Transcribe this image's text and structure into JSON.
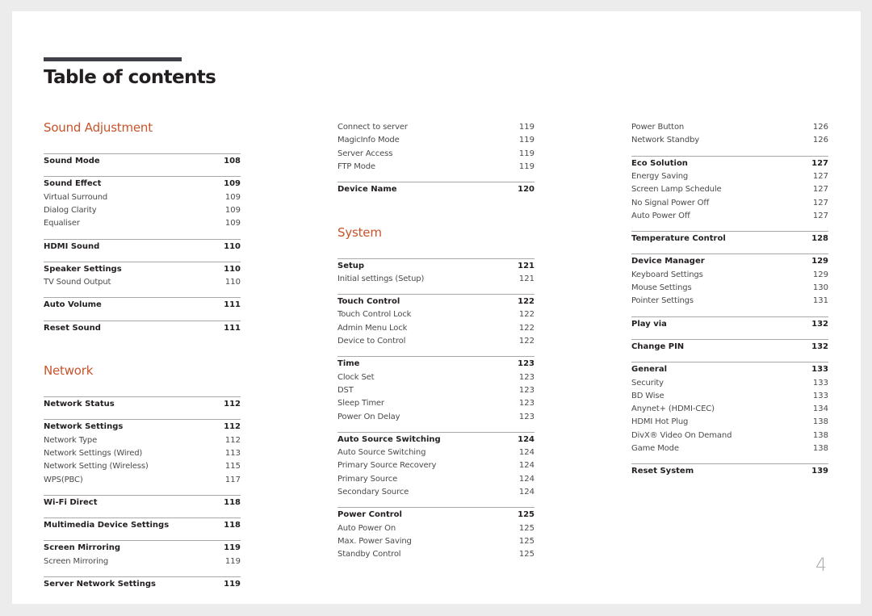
{
  "document": {
    "title": "Table of contents",
    "page_number": "4",
    "accent_color": "#c9532a"
  },
  "columns": [
    {
      "blocks": [
        {
          "type": "heading",
          "text": "Sound Adjustment"
        },
        {
          "type": "group",
          "items": [
            {
              "label": "Sound Mode",
              "page": "108",
              "major": true
            }
          ]
        },
        {
          "type": "group",
          "items": [
            {
              "label": "Sound Effect",
              "page": "109",
              "major": true
            },
            {
              "label": "Virtual Surround",
              "page": "109"
            },
            {
              "label": "Dialog Clarity",
              "page": "109"
            },
            {
              "label": "Equaliser",
              "page": "109"
            }
          ]
        },
        {
          "type": "group",
          "items": [
            {
              "label": "HDMI Sound",
              "page": "110",
              "major": true
            }
          ]
        },
        {
          "type": "group",
          "items": [
            {
              "label": "Speaker Settings",
              "page": "110",
              "major": true
            },
            {
              "label": "TV Sound Output",
              "page": "110"
            }
          ]
        },
        {
          "type": "group",
          "items": [
            {
              "label": "Auto Volume",
              "page": "111",
              "major": true
            }
          ]
        },
        {
          "type": "group",
          "items": [
            {
              "label": "Reset Sound",
              "page": "111",
              "major": true
            }
          ]
        },
        {
          "type": "heading",
          "text": "Network"
        },
        {
          "type": "group",
          "items": [
            {
              "label": "Network Status",
              "page": "112",
              "major": true
            }
          ]
        },
        {
          "type": "group",
          "items": [
            {
              "label": "Network Settings",
              "page": "112",
              "major": true
            },
            {
              "label": "Network Type",
              "page": "112"
            },
            {
              "label": "Network Settings (Wired)",
              "page": "113"
            },
            {
              "label": "Network Setting (Wireless)",
              "page": "115"
            },
            {
              "label": "WPS(PBC)",
              "page": "117"
            }
          ]
        },
        {
          "type": "group",
          "items": [
            {
              "label": "Wi-Fi Direct",
              "page": "118",
              "major": true
            }
          ]
        },
        {
          "type": "group",
          "items": [
            {
              "label": "Multimedia Device Settings",
              "page": "118",
              "major": true
            }
          ]
        },
        {
          "type": "group",
          "items": [
            {
              "label": "Screen Mirroring",
              "page": "119",
              "major": true
            },
            {
              "label": "Screen Mirroring",
              "page": "119"
            }
          ]
        },
        {
          "type": "group",
          "items": [
            {
              "label": "Server Network Settings",
              "page": "119",
              "major": true
            }
          ]
        }
      ]
    },
    {
      "blocks": [
        {
          "type": "group",
          "norule": true,
          "items": [
            {
              "label": "Connect to server",
              "page": "119"
            },
            {
              "label": "MagicInfo Mode",
              "page": "119"
            },
            {
              "label": "Server Access",
              "page": "119"
            },
            {
              "label": "FTP Mode",
              "page": "119"
            }
          ]
        },
        {
          "type": "group",
          "items": [
            {
              "label": "Device Name",
              "page": "120",
              "major": true
            }
          ]
        },
        {
          "type": "heading",
          "text": "System"
        },
        {
          "type": "group",
          "items": [
            {
              "label": "Setup",
              "page": "121",
              "major": true
            },
            {
              "label": "Initial settings (Setup)",
              "page": "121"
            }
          ]
        },
        {
          "type": "group",
          "items": [
            {
              "label": "Touch Control",
              "page": "122",
              "major": true
            },
            {
              "label": "Touch Control Lock",
              "page": "122"
            },
            {
              "label": "Admin Menu Lock",
              "page": "122"
            },
            {
              "label": "Device to Control",
              "page": "122"
            }
          ]
        },
        {
          "type": "group",
          "items": [
            {
              "label": "Time",
              "page": "123",
              "major": true
            },
            {
              "label": "Clock Set",
              "page": "123"
            },
            {
              "label": "DST",
              "page": "123"
            },
            {
              "label": "Sleep Timer",
              "page": "123"
            },
            {
              "label": "Power On Delay",
              "page": "123"
            }
          ]
        },
        {
          "type": "group",
          "items": [
            {
              "label": "Auto Source Switching",
              "page": "124",
              "major": true
            },
            {
              "label": "Auto Source Switching",
              "page": "124"
            },
            {
              "label": "Primary Source Recovery",
              "page": "124"
            },
            {
              "label": "Primary Source",
              "page": "124"
            },
            {
              "label": "Secondary Source",
              "page": "124"
            }
          ]
        },
        {
          "type": "group",
          "items": [
            {
              "label": "Power Control",
              "page": "125",
              "major": true
            },
            {
              "label": "Auto Power On",
              "page": "125"
            },
            {
              "label": "Max. Power Saving",
              "page": "125"
            },
            {
              "label": "Standby Control",
              "page": "125"
            }
          ]
        }
      ]
    },
    {
      "blocks": [
        {
          "type": "group",
          "norule": true,
          "items": [
            {
              "label": "Power Button",
              "page": "126"
            },
            {
              "label": "Network Standby",
              "page": "126"
            }
          ]
        },
        {
          "type": "group",
          "items": [
            {
              "label": "Eco Solution",
              "page": "127",
              "major": true
            },
            {
              "label": "Energy Saving",
              "page": "127"
            },
            {
              "label": "Screen Lamp Schedule",
              "page": "127"
            },
            {
              "label": "No Signal Power Off",
              "page": "127"
            },
            {
              "label": "Auto Power Off",
              "page": "127"
            }
          ]
        },
        {
          "type": "group",
          "items": [
            {
              "label": "Temperature Control",
              "page": "128",
              "major": true
            }
          ]
        },
        {
          "type": "group",
          "items": [
            {
              "label": "Device Manager",
              "page": "129",
              "major": true
            },
            {
              "label": "Keyboard Settings",
              "page": "129"
            },
            {
              "label": "Mouse Settings",
              "page": "130"
            },
            {
              "label": "Pointer Settings",
              "page": "131"
            }
          ]
        },
        {
          "type": "group",
          "items": [
            {
              "label": "Play via",
              "page": "132",
              "major": true
            }
          ]
        },
        {
          "type": "group",
          "items": [
            {
              "label": "Change PIN",
              "page": "132",
              "major": true
            }
          ]
        },
        {
          "type": "group",
          "items": [
            {
              "label": "General",
              "page": "133",
              "major": true
            },
            {
              "label": "Security",
              "page": "133"
            },
            {
              "label": "BD Wise",
              "page": "133"
            },
            {
              "label": "Anynet+ (HDMI-CEC)",
              "page": "134"
            },
            {
              "label": "HDMI Hot Plug",
              "page": "138"
            },
            {
              "label": "DivX® Video On Demand",
              "page": "138"
            },
            {
              "label": "Game Mode",
              "page": "138"
            }
          ]
        },
        {
          "type": "group",
          "items": [
            {
              "label": "Reset System",
              "page": "139",
              "major": true
            }
          ]
        }
      ]
    }
  ]
}
